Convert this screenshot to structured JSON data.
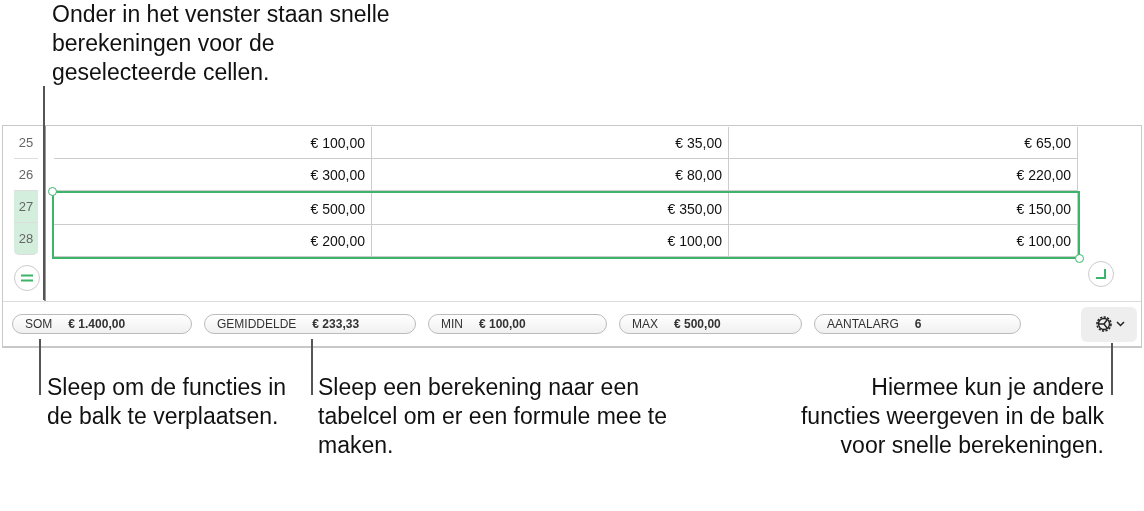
{
  "top_callout": "Onder in het venster staan snelle berekeningen voor de geselecteerde cellen.",
  "table": {
    "rows": [
      {
        "number": "25",
        "selected": false,
        "cells": [
          "€ 100,00",
          "€ 35,00",
          "€ 65,00"
        ]
      },
      {
        "number": "26",
        "selected": false,
        "cells": [
          "€ 300,00",
          "€ 80,00",
          "€ 220,00"
        ]
      },
      {
        "number": "27",
        "selected": true,
        "cells": [
          "€ 500,00",
          "€ 350,00",
          "€ 150,00"
        ]
      },
      {
        "number": "28",
        "selected": true,
        "cells": [
          "€ 200,00",
          "€ 100,00",
          "€ 100,00"
        ]
      }
    ]
  },
  "quick_calcs": [
    {
      "label": "SOM",
      "value": "€ 1.400,00"
    },
    {
      "label": "GEMIDDELDE",
      "value": "€ 233,33"
    },
    {
      "label": "MIN",
      "value": "€ 100,00"
    },
    {
      "label": "MAX",
      "value": "€ 500,00"
    },
    {
      "label": "AANTALARG",
      "value": "6"
    }
  ],
  "callouts": [
    "Sleep om de functies in de balk te verplaatsen.",
    "Sleep een berekening naar een tabelcel om er een formule mee te maken.",
    "Hiermee kun je andere functies weergeven in de balk voor snelle berekeningen."
  ]
}
